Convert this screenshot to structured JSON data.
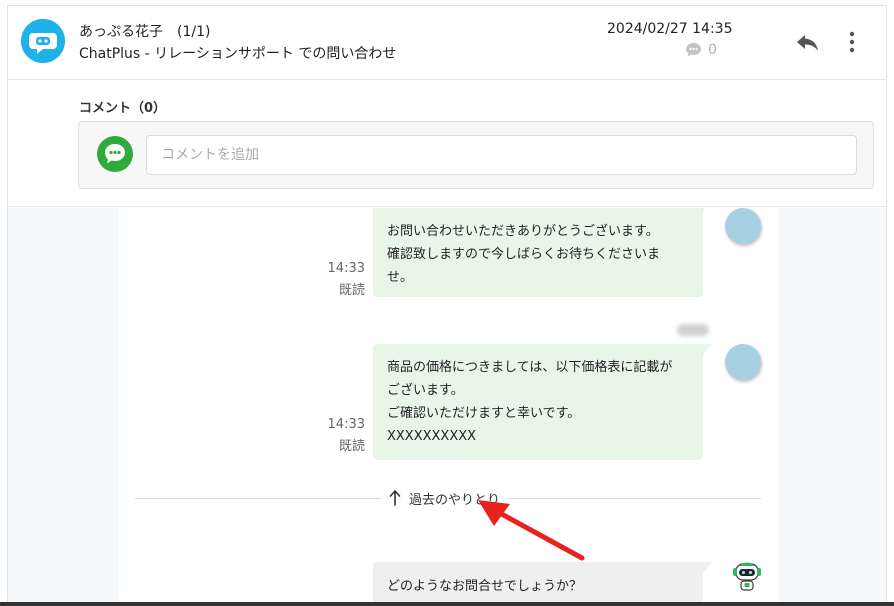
{
  "header": {
    "sender_name": "あっぷる花子",
    "message_count": "(1/1)",
    "subject": "ChatPlus - リレーションサポート での問い合わせ",
    "datetime": "2024/02/27 14:35",
    "comment_count": "0",
    "icons": {
      "logo": "chatplus-logo-icon",
      "comment": "comment-bubble-icon",
      "reply": "reply-icon",
      "more": "more-vertical-icon"
    }
  },
  "comments": {
    "title": "コメント（0）",
    "input_placeholder": "コメントを追加",
    "avatar_color": "#2eab3b"
  },
  "messages": [
    {
      "from": "operator",
      "time": "14:33",
      "status": "既読",
      "lines": [
        "お問い合わせいただきありがとうございます。",
        "確認致しますので今しばらくお待ちくださいま",
        "せ。"
      ]
    },
    {
      "from": "operator",
      "time": "14:33",
      "status": "既読",
      "lines": [
        "商品の価格につきましては、以下価格表に記載が",
        "ございます。",
        "ご確認いただけますと幸いです。",
        "XXXXXXXXXX"
      ]
    },
    {
      "from": "bot",
      "lines": [
        "どのようなお問合せでしょうか？"
      ]
    }
  ],
  "past_link": {
    "label": "過去のやりとり",
    "icon": "arrow-up-icon"
  },
  "colors": {
    "brand": "#1fb2e8",
    "operator_bubble": "#e8f6e8",
    "bot_bubble": "#efefef",
    "annotation_arrow": "#e8231f"
  }
}
